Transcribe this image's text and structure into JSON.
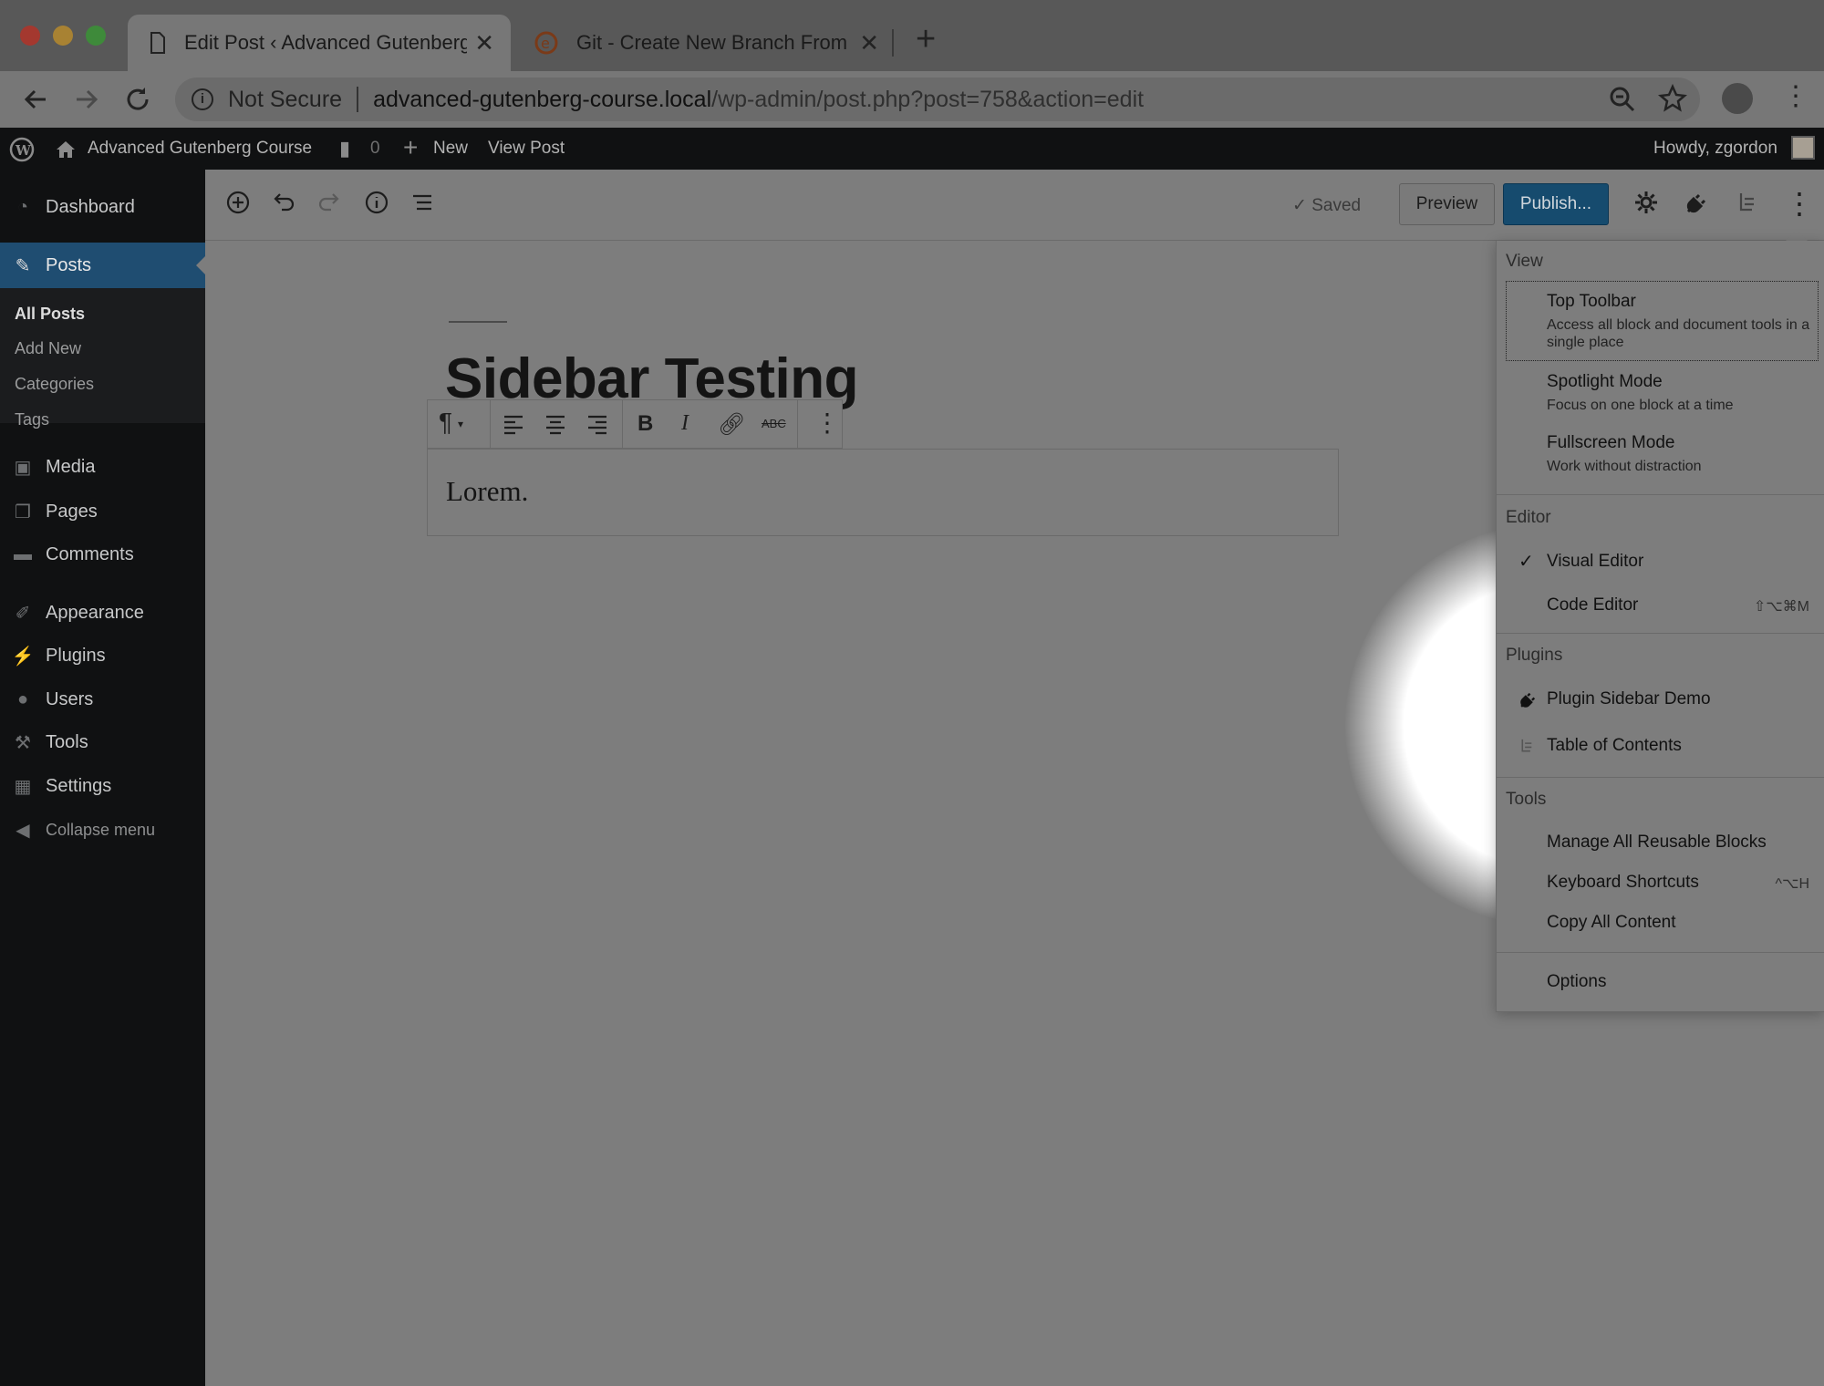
{
  "browser": {
    "tabs": [
      {
        "title": "Edit Post ‹ Advanced Gutenberg",
        "icon": "document-icon"
      },
      {
        "title": "Git - Create New Branch From",
        "icon": "site-favicon"
      }
    ],
    "address": {
      "security_label": "Not Secure",
      "url_domain": "advanced-gutenberg-course.local",
      "url_path": "/wp-admin/post.php?post=758&action=edit"
    }
  },
  "admin_bar": {
    "site_name": "Advanced Gutenberg Course",
    "comments_count": "0",
    "new_label": "New",
    "view_post_label": "View Post",
    "greeting": "Howdy, zgordon"
  },
  "sidebar": {
    "items": [
      {
        "label": "Dashboard",
        "icon": "dashboard-icon"
      },
      {
        "label": "Posts",
        "icon": "pin-icon"
      },
      {
        "label": "Media",
        "icon": "media-icon"
      },
      {
        "label": "Pages",
        "icon": "pages-icon"
      },
      {
        "label": "Comments",
        "icon": "comment-icon"
      },
      {
        "label": "Appearance",
        "icon": "brush-icon"
      },
      {
        "label": "Plugins",
        "icon": "plug-icon"
      },
      {
        "label": "Users",
        "icon": "user-icon"
      },
      {
        "label": "Tools",
        "icon": "wrench-icon"
      },
      {
        "label": "Settings",
        "icon": "settings-icon"
      },
      {
        "label": "Collapse menu",
        "icon": "collapse-icon"
      }
    ],
    "posts_submenu": [
      "All Posts",
      "Add New",
      "Categories",
      "Tags"
    ]
  },
  "editor": {
    "saved_label": "Saved",
    "preview_label": "Preview",
    "publish_label": "Publish...",
    "post_title": "Sidebar Testing",
    "paragraph_text": "Lorem."
  },
  "more_menu": {
    "view_label": "View",
    "view_options": [
      {
        "title": "Top Toolbar",
        "desc": "Access all block and document tools in a single place"
      },
      {
        "title": "Spotlight Mode",
        "desc": "Focus on one block at a time"
      },
      {
        "title": "Fullscreen Mode",
        "desc": "Work without distraction"
      }
    ],
    "editor_label": "Editor",
    "editor_options": [
      {
        "title": "Visual Editor",
        "checked": true,
        "shortcut": ""
      },
      {
        "title": "Code Editor",
        "checked": false,
        "shortcut": "⇧⌥⌘M"
      }
    ],
    "plugins_label": "Plugins",
    "plugin_options": [
      {
        "title": "Plugin Sidebar Demo",
        "icon": "plug-icon"
      },
      {
        "title": "Table of Contents",
        "icon": "table-of-contents-icon"
      }
    ],
    "tools_label": "Tools",
    "tool_options": [
      {
        "title": "Manage All Reusable Blocks",
        "shortcut": ""
      },
      {
        "title": "Keyboard Shortcuts",
        "shortcut": "^⌥H"
      },
      {
        "title": "Copy All Content",
        "shortcut": ""
      }
    ],
    "options_label": "Options"
  },
  "colors": {
    "admin_dark": "#101112",
    "posts_highlight": "#1f4d71",
    "publish_button": "#164b6e",
    "overlay_gray": "#7d7d7d"
  }
}
